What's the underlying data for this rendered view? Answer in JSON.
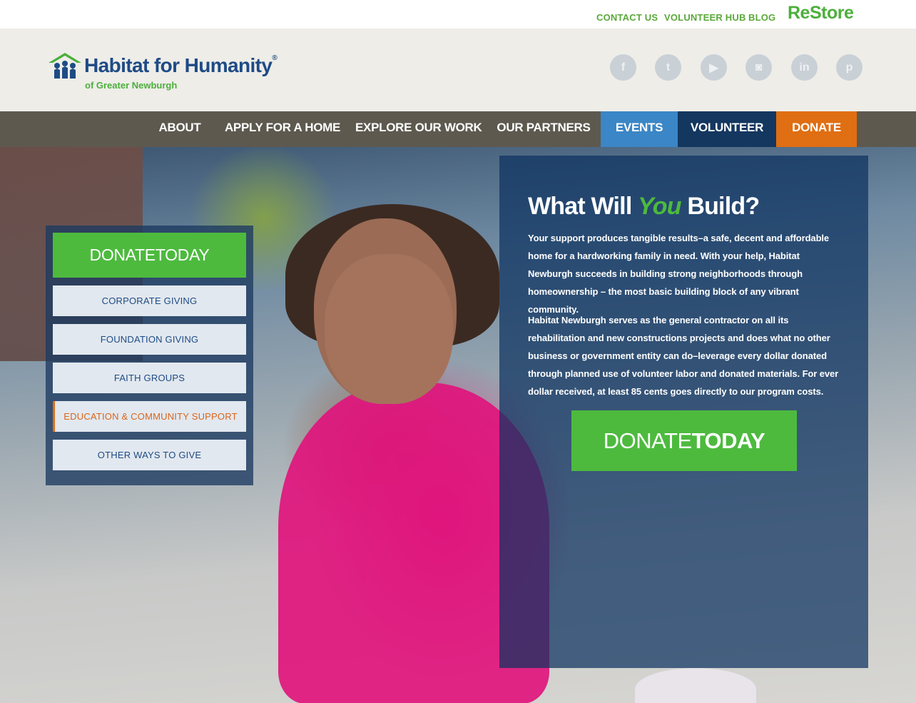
{
  "topbar": {
    "contact": "CONTACT US",
    "volunteer_hub": "VOLUNTEER HUB",
    "blog": "BLOG",
    "restore": "ReStore"
  },
  "header": {
    "brand": "Habitat for Humanity",
    "registered": "®",
    "subtitle": "of Greater Newburgh",
    "social": [
      {
        "name": "facebook-icon",
        "glyph": "f"
      },
      {
        "name": "twitter-icon",
        "glyph": "t"
      },
      {
        "name": "youtube-icon",
        "glyph": "▶"
      },
      {
        "name": "instagram-icon",
        "glyph": "◙"
      },
      {
        "name": "linkedin-icon",
        "glyph": "in"
      },
      {
        "name": "pinterest-icon",
        "glyph": "p"
      }
    ]
  },
  "nav": {
    "items": [
      "ABOUT",
      "APPLY FOR A HOME",
      "EXPLORE OUR WORK",
      "OUR PARTNERS",
      "EVENTS",
      "VOLUNTEER",
      "DONATE"
    ]
  },
  "side": {
    "donate": "DONATETODAY",
    "links": [
      "CORPORATE GIVING",
      "FOUNDATION GIVING",
      "FAITH GROUPS",
      "EDUCATION & COMMUNITY SUPPORT",
      "OTHER WAYS TO GIVE"
    ],
    "active_index": 3
  },
  "content": {
    "title_a": "What Will ",
    "title_you": "You",
    "title_b": " Build?",
    "p1": "Your support produces tangible results–a safe, decent and affordable home for a hardworking family in need. With your help, Habitat Newburgh succeeds in building strong neighborhoods through homeownership – the most basic building block of any vibrant community.",
    "p2": "Habitat Newburgh serves as the general contractor on all its rehabilitation and new constructions projects and does what no other business or government entity can do–leverage every dollar donated through planned use of volunteer labor and donated materials. For ever dollar received, at least 85 cents goes directly to our program costs.",
    "cta_a": "DONATE",
    "cta_b": "TODAY"
  },
  "colors": {
    "green": "#4dba3e",
    "navy": "#1e4b85",
    "orange": "#e06e12",
    "nav_bg": "#5d594f",
    "events_blue": "#3b86c6",
    "volunteer_navy": "#14375f"
  }
}
